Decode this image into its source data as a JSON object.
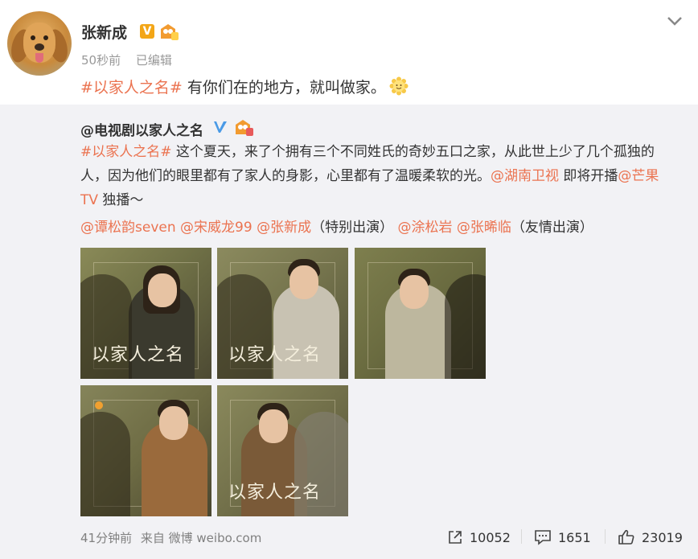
{
  "post": {
    "username": "张新成",
    "time": "50秒前",
    "edited": "已编辑",
    "text_tag": "#以家人之名#",
    "text_body": " 有你们在的地方，就叫做家。",
    "vip_mark": "V"
  },
  "repost": {
    "username": "@电视剧以家人之名",
    "tag": "#以家人之名#",
    "body_1": " 这个夏天，来了个拥有三个不同姓氏的奇妙五口之家，从此世上少了几个孤独的人，因为他们的眼里都有了家人的身影，心里都有了温暖柔软的光。",
    "mention_station": "@湖南卫视",
    "body_2": " 即将开播",
    "mention_platform": "@芒果TV",
    "body_3": " 独播～",
    "mentions": {
      "m1": "@谭松韵seven",
      "m2": "@宋威龙99",
      "m3": "@张新成",
      "note1": "（特别出演）",
      "m4": "@涂松岩",
      "m5": "@张晞临",
      "note2": "（友情出演）"
    },
    "photos": [
      {
        "caption": "以家人之名",
        "kind": "woman-smile"
      },
      {
        "caption": "以家人之名",
        "kind": "man-shirt"
      },
      {
        "caption": "",
        "kind": "young-man-smile"
      },
      {
        "caption": "",
        "kind": "man-jacket"
      },
      {
        "caption": "以家人之名",
        "kind": "older-man"
      }
    ],
    "footer": {
      "time": "41分钟前",
      "from": "来自 微博 weibo.com",
      "shares": "10052",
      "comments": "1651",
      "likes": "23019"
    }
  },
  "colors": {
    "accent": "#eb7350",
    "repost_bg": "#f2f2f5",
    "vip": "#f3a617",
    "verified_blue": "#4a9ae6"
  },
  "icons": [
    "chevron-down-icon",
    "vip-icon",
    "level-icon",
    "smile-emoji-icon",
    "verified-icon",
    "share-icon",
    "comment-icon",
    "like-icon"
  ]
}
